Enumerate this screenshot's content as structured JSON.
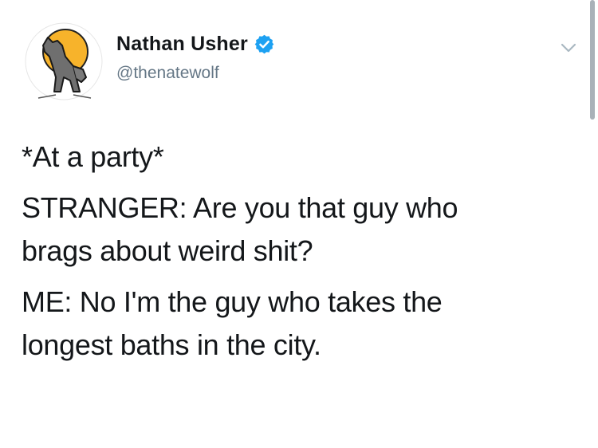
{
  "author": {
    "display_name": "Nathan Usher",
    "handle": "@thenatewolf",
    "verified": true,
    "avatar_icon": "howling-wolf-moon-icon"
  },
  "tweet": {
    "line1": "*At a party*",
    "line2a": "STRANGER: Are you that guy who",
    "line2b": "brags about weird shit?",
    "line3a": "ME: No I'm the guy who takes the",
    "line3b": "longest baths in the city."
  },
  "colors": {
    "verified_badge": "#1da1f2",
    "handle": "#657786",
    "text": "#14171a",
    "moon": "#f7b32b"
  }
}
